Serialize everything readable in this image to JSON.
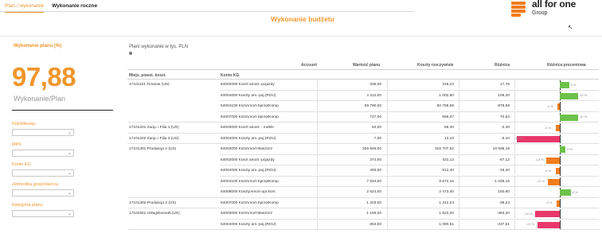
{
  "tabs": [
    {
      "label": "Plan / wykonanie",
      "active": true
    },
    {
      "label": "Wykonanie roczne",
      "active": false
    }
  ],
  "title": "Wykonanie budżetu",
  "logo": {
    "name": "all for one",
    "sub": "Group"
  },
  "kpi": {
    "label": "Wykonanie planu (%)",
    "value": "97,88",
    "sub": "Wykonanie/Plan"
  },
  "filters": [
    {
      "label": "Rok/Miesiąc"
    },
    {
      "label": "MPK"
    },
    {
      "label": "Konto KG"
    },
    {
      "label": "Jednostka gospodarcza"
    },
    {
      "label": "Kategoria planu"
    }
  ],
  "table": {
    "caption": "Plan/ wykonanie w tys. PLN",
    "headers": {
      "account": "Account",
      "plan": "Wartość planu",
      "cost": "Koszty rzeczywiste",
      "diff": "Różnica",
      "pct": "Różnica procentowa"
    },
    "subheaders": {
      "mpk": "Miejs. powst. koszt.",
      "konto": "Konto KG"
    },
    "rows": [
      {
        "mpk": "17101101 Finanse (US)",
        "konto": "64002000 Koszt amort.-pojazdy",
        "plan": "336,00",
        "cost": "318,24",
        "diff": "17,76",
        "pct": 5,
        "pct_label": "5 %"
      },
      {
        "mpk": "",
        "konto": "64004000 Koszty am.-poj.(ROU)",
        "plan": "1 112,00",
        "cost": "1 002,80",
        "diff": "109,20",
        "pct": 10,
        "pct_label": "10 %"
      },
      {
        "mpk": "",
        "konto": "64004100 KsztAmort-SprzętKomp",
        "plan": "59 790,00",
        "cost": "60 769,59",
        "diff": "-979,59",
        "pct": -2,
        "pct_label": "-2 %"
      },
      {
        "mpk": "",
        "konto": "64007000 KsztAmort-SprzętKomp",
        "plan": "727,00",
        "cost": "656,37",
        "diff": "70,63",
        "pct": 10,
        "pct_label": "10 %"
      },
      {
        "mpk": "17101201 Zaop. i Filia 1 (US)",
        "konto": "64003000 Koszt amort. - meble",
        "plan": "54,00",
        "cost": "56,40",
        "diff": "-2,40",
        "pct": -4,
        "pct_label": "-4 %"
      },
      {
        "mpk": "17101202 Zaop. i Filia 3 (US)",
        "konto": "64004000 Koszty am.-poj.(ROU)",
        "plan": "7,00",
        "cost": "12,10",
        "diff": "-5,10",
        "pct": -42,
        "pct_label": "-42 %"
      },
      {
        "mpk": "17101301 Produkcja 1 (US)",
        "konto": "64003000 KsztAmort-MaszUrz",
        "plan": "326 846,00",
        "cost": "315 707,82",
        "diff": "10 938,18",
        "pct": 3,
        "pct_label": "3 %"
      },
      {
        "mpk": "",
        "konto": "64002000 Koszt amort.-pojazdy",
        "plan": "374,00",
        "cost": "431,12",
        "diff": "-57,12",
        "pct": -13,
        "pct_label": "-13 %"
      },
      {
        "mpk": "",
        "konto": "64004000 Koszty am.-poj.(ROU)",
        "plan": "493,00",
        "cost": "512,40",
        "diff": "-19,40",
        "pct": -4,
        "pct_label": "-4 %"
      },
      {
        "mpk": "",
        "konto": "64004100 KsztAmort-SprzętKomp",
        "plan": "7 634,00",
        "cost": "8 672,16",
        "diff": "-1 038,16",
        "pct": -12,
        "pct_label": "-12 %"
      },
      {
        "mpk": "",
        "konto": "64008000 KosztyAmort-opr.kom.",
        "plan": "2 624,00",
        "cost": "2 473,40",
        "diff": "150,60",
        "pct": 6,
        "pct_label": "6 %"
      },
      {
        "mpk": "17101302 Produkcja 2 (US)",
        "konto": "64007000 KsztAmort-SprzętKomp",
        "plan": "1 203,00",
        "cost": "1 242,24",
        "diff": "-39,24",
        "pct": -3,
        "pct_label": "-3 %"
      },
      {
        "mpk": "17101501 Usługi/konsult.(US)",
        "konto": "64003000 KsztAmort-MaszUrz",
        "plan": "1 159,00",
        "cost": "1 522,20",
        "diff": "-363,20",
        "pct": -24,
        "pct_label": "-24 %"
      },
      {
        "mpk": "",
        "konto": "64004000 Koszty am.-poj.(ROU)",
        "plan": "853,00",
        "cost": "1 090,51",
        "diff": "-237,51",
        "pct": -22,
        "pct_label": "-22 %"
      }
    ]
  },
  "colors": {
    "accent": "#f0962d",
    "positive": "#6cc24a",
    "negative": "#e8386b",
    "small_negative": "#f07d1e"
  }
}
